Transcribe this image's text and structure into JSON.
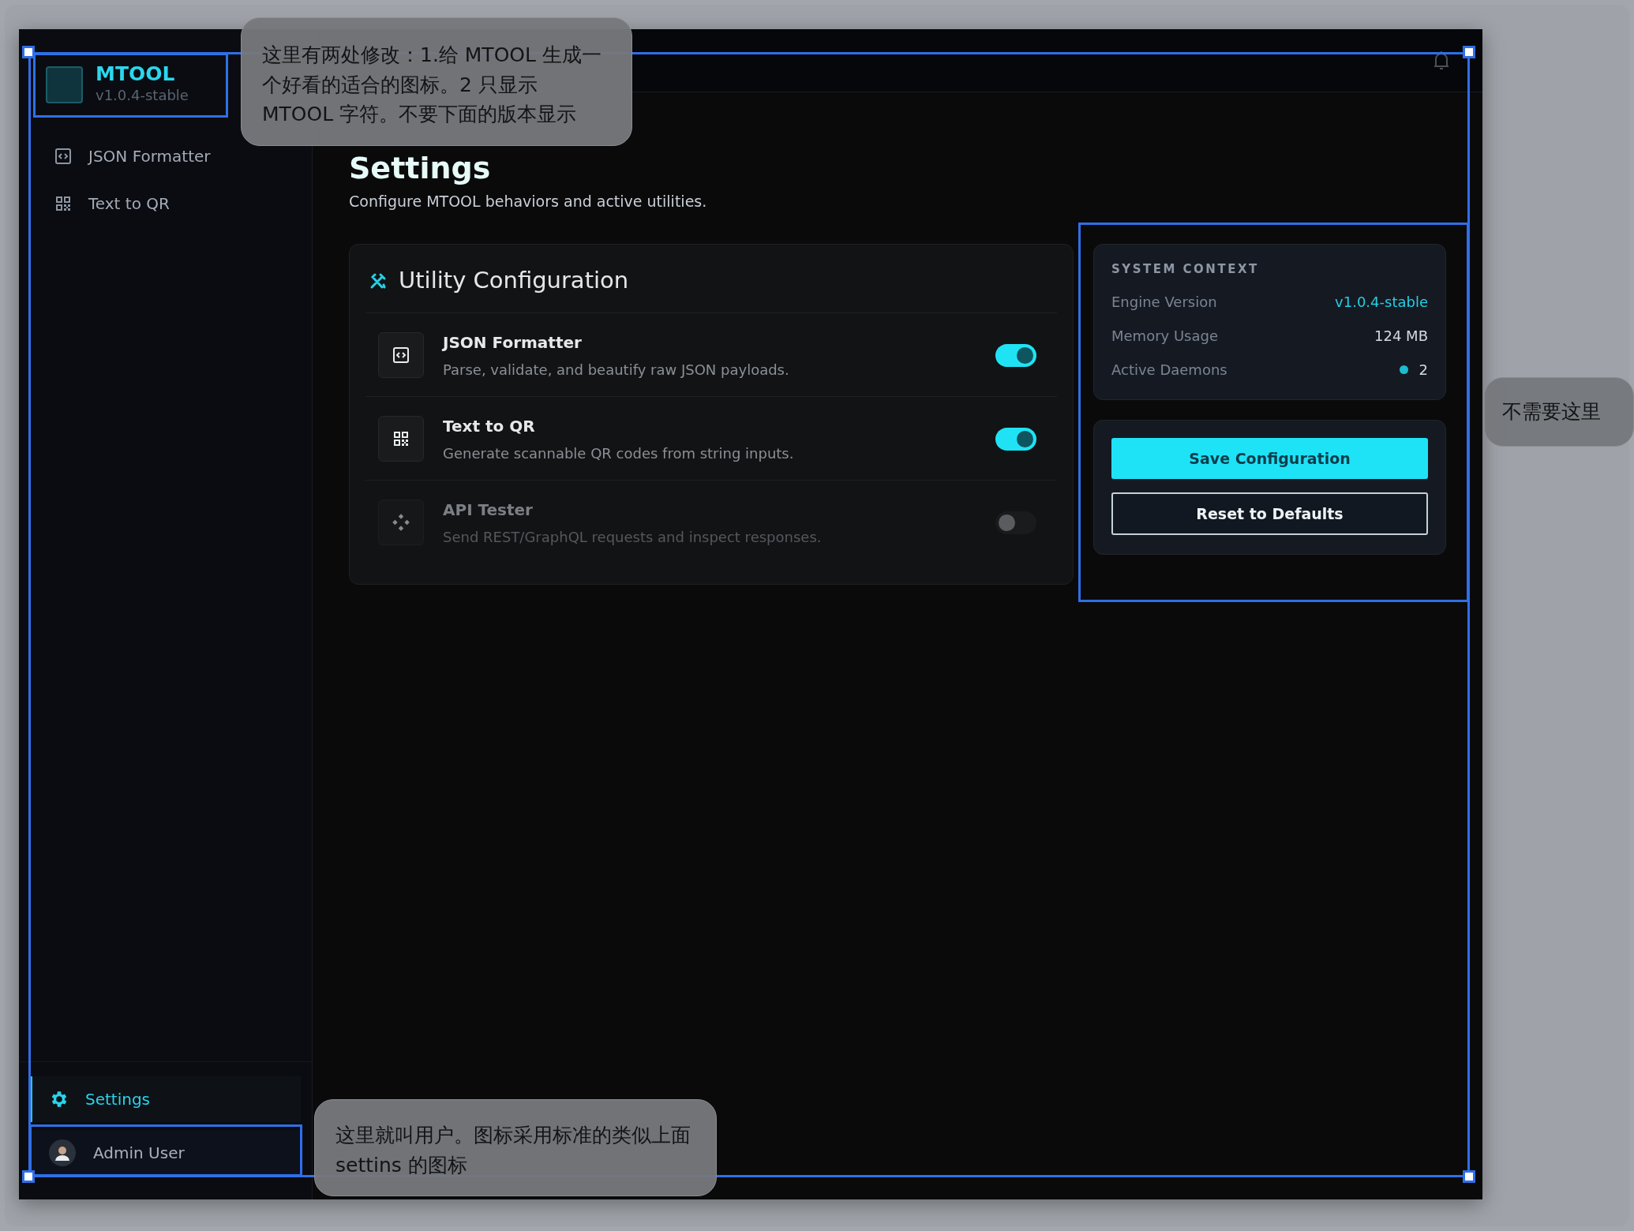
{
  "logo": {
    "name": "MTOOL",
    "version": "v1.0.4-stable"
  },
  "sidebar": {
    "items": [
      {
        "label": "JSON Formatter",
        "selected": false
      },
      {
        "label": "Text to QR",
        "selected": false
      }
    ],
    "footer_items": [
      {
        "label": "Settings",
        "selected": true
      }
    ],
    "user": {
      "name": "Admin User"
    }
  },
  "page": {
    "title": "Settings",
    "subtitle": "Configure MTOOL behaviors and active utilities."
  },
  "utility_card": {
    "title": "Utility Configuration",
    "utilities": [
      {
        "name": "JSON Formatter",
        "description": "Parse, validate, and beautify raw JSON payloads.",
        "on": true
      },
      {
        "name": "Text to QR",
        "description": "Generate scannable QR codes from string inputs.",
        "on": true
      },
      {
        "name": "API Tester",
        "description": "Send REST/GraphQL requests and inspect responses.",
        "on": false
      }
    ]
  },
  "system_context": {
    "title": "SYSTEM CONTEXT",
    "rows": [
      {
        "label": "Engine Version",
        "value": "v1.0.4-stable",
        "kind": "accent"
      },
      {
        "label": "Memory Usage",
        "value": "124 MB",
        "kind": "plain"
      },
      {
        "label": "Active Daemons",
        "value": "2",
        "kind": "status"
      }
    ]
  },
  "actions": [
    {
      "label": "Save Configuration",
      "kind": "primary"
    },
    {
      "label": "Reset to Defaults",
      "kind": "outline"
    }
  ],
  "annotations": [
    {
      "text": "这里有两处修改：1.给 MTOOL 生成一个好看的适合的图标。2 只显示 MTOOL 字符。不要下面的版本显示"
    },
    {
      "text": "这里就叫用户。图标采用标准的类似上面 settins 的图标"
    },
    {
      "text": "不需要这里"
    }
  ]
}
